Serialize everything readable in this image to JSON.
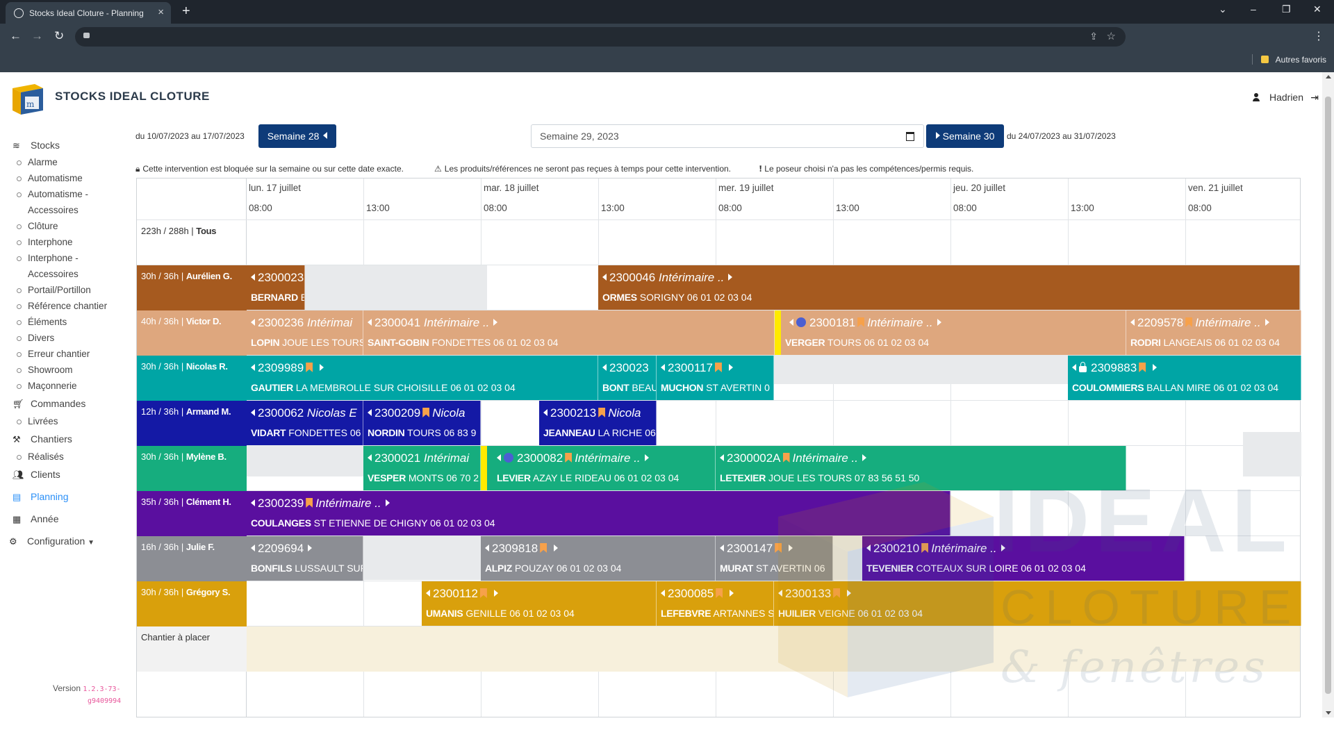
{
  "browser": {
    "tab_title": "Stocks Ideal Cloture - Planning",
    "bookmarks_label": "Autres favoris"
  },
  "app": {
    "brand": "STOCKS IDEAL CLOTURE",
    "user": "Hadrien",
    "version_label": "Version",
    "version_value": "1.2.3-73-",
    "version_hash": "g9409994"
  },
  "sidebar": {
    "stocks": "Stocks",
    "stock_items": [
      "Alarme",
      "Automatisme",
      "Automatisme -",
      "Accessoires",
      "Clôture",
      "Interphone",
      "Interphone -",
      "Accessoires",
      "Portail/Portillon",
      "Référence chantier",
      "Éléments",
      "Divers",
      "Erreur chantier",
      "Showroom",
      "Maçonnerie"
    ],
    "commandes": "Commandes",
    "livrees": "Livrées",
    "chantiers": "Chantiers",
    "realises": "Réalisés",
    "clients": "Clients",
    "planning": "Planning",
    "annee": "Année",
    "configuration": "Configuration"
  },
  "week_nav": {
    "prev_range": "du 10/07/2023 au 17/07/2023",
    "prev_label": "Semaine 28",
    "current": "Semaine 29, 2023",
    "next_label": "Semaine 30",
    "next_range": "du 24/07/2023 au 31/07/2023"
  },
  "legend": {
    "blocked": "Cette intervention est bloquée sur la semaine ou sur cette date exacte.",
    "late": "Les produits/références ne seront pas reçues à temps pour cette intervention.",
    "skills": "Le poseur choisi n'a pas les compétences/permis requis."
  },
  "days": [
    "lun. 17 juillet",
    "mar. 18 juillet",
    "mer. 19 juillet",
    "jeu. 20 juillet",
    "ven. 21 juillet"
  ],
  "hours": [
    "08:00",
    "13:00",
    "08:00",
    "13:00",
    "08:00",
    "13:00",
    "08:00",
    "13:00",
    "08:00"
  ],
  "rows": {
    "all": {
      "hours": "223h / 288h",
      "name": "Tous"
    },
    "aurelien": {
      "hours": "30h / 36h",
      "name": "Aurélien G.",
      "color": "#a65a1f"
    },
    "victor": {
      "hours": "40h / 36h",
      "name": "Victor D.",
      "color": "#dea77e"
    },
    "nicolas": {
      "hours": "30h / 36h",
      "name": "Nicolas R.",
      "color": "#00a5a5"
    },
    "armand": {
      "hours": "12h / 36h",
      "name": "Armand M.",
      "color": "#1419a5"
    },
    "mylene": {
      "hours": "30h / 36h",
      "name": "Mylène B.",
      "color": "#16ad7e"
    },
    "clement": {
      "hours": "35h / 36h",
      "name": "Clément H.",
      "color": "#5a0f9f"
    },
    "julie": {
      "hours": "16h / 36h",
      "name": "Julie F.",
      "color": "#8c8e94"
    },
    "gregory": {
      "hours": "30h / 36h",
      "name": "Grégory S.",
      "color": "#d9a00c"
    },
    "place": {
      "name": "Chantier à placer"
    }
  },
  "events": {
    "a1": {
      "code": "2300023",
      "flag": "",
      "name": "BERNARD",
      "rest": "E"
    },
    "a2": {
      "code": "2300046",
      "flag": "Intérimaire ..",
      "name": "ORMES",
      "rest": "SORIGNY 06 01 02 03 04"
    },
    "v1": {
      "code": "2300236",
      "flag": "Intérimai",
      "name": "LOPIN",
      "rest": "JOUE LES TOURS"
    },
    "v2": {
      "code": "2300041",
      "flag": "Intérimaire ..",
      "name": "SAINT-GOBIN",
      "rest": "FONDETTES 06 01 02 03 04"
    },
    "v3": {
      "code": "2300181",
      "flag": "Intérimaire ..",
      "name": "VERGER",
      "rest": "TOURS 06 01 02 03 04"
    },
    "v4": {
      "code": "2209578",
      "flag": "Intérimaire ..",
      "name": "RODRI",
      "rest": "LANGEAIS 06 01 02 03 04"
    },
    "n1": {
      "code": "2309989",
      "flag": "",
      "name": "GAUTIER",
      "rest": "LA MEMBROLLE SUR CHOISILLE 06 01 02 03 04"
    },
    "n2": {
      "code": "230023",
      "flag": "",
      "name": "BONT",
      "rest": "BEAU"
    },
    "n3": {
      "code": "2300117",
      "flag": "",
      "name": "MUCHON",
      "rest": "ST AVERTIN 0"
    },
    "n4": {
      "code": "2309883",
      "flag": "",
      "name": "COULOMMIERS",
      "rest": "BALLAN MIRE 06 01 02 03 04"
    },
    "r1": {
      "code": "2300062",
      "flag": "Nicolas E",
      "name": "VIDART",
      "rest": "FONDETTES 06"
    },
    "r2": {
      "code": "2300209",
      "flag": "Nicola",
      "name": "NORDIN",
      "rest": "TOURS 06 83 9"
    },
    "r3": {
      "code": "2300213",
      "flag": "Nicola",
      "name": "JEANNEAU",
      "rest": "LA RICHE 06"
    },
    "m1": {
      "code": "2300021",
      "flag": "Intérimai",
      "name": "VESPER",
      "rest": "MONTS 06 70 2"
    },
    "m2": {
      "code": "2300082",
      "flag": "Intérimaire ..",
      "name": "LEVIER",
      "rest": "AZAY LE RIDEAU 06 01 02 03 04"
    },
    "m3": {
      "code": "2300002A",
      "flag": "Intérimaire ..",
      "name": "LETEXIER",
      "rest": "JOUE LES TOURS 07 83 56 51 50"
    },
    "c1": {
      "code": "2300239",
      "flag": "Intérimaire ..",
      "name": "COULANGES",
      "rest": "ST ETIENNE DE CHIGNY 06 01 02 03 04"
    },
    "j1": {
      "code": "2209694",
      "flag": "",
      "name": "BONFILS",
      "rest": "LUSSAULT SUF"
    },
    "j2": {
      "code": "2309818",
      "flag": "",
      "name": "ALPIZ",
      "rest": "POUZAY 06 01 02 03 04"
    },
    "j3": {
      "code": "2300147",
      "flag": "",
      "name": "MURAT",
      "rest": "ST AVERTIN 06"
    },
    "j4": {
      "code": "2300210",
      "flag": "Intérimaire ..",
      "name": "TEVENIER",
      "rest": "COTEAUX SUR LOIRE 06 01 02 03 04"
    },
    "g1": {
      "code": "2300112",
      "flag": "",
      "name": "UMANIS",
      "rest": "GENILLE 06 01 02 03 04"
    },
    "g2": {
      "code": "2300085",
      "flag": "",
      "name": "LEFEBVRE",
      "rest": "ARTANNES S"
    },
    "g3": {
      "code": "2300133",
      "flag": "",
      "name": "HUILIER",
      "rest": "VEIGNE 06 01 02 03 04"
    }
  },
  "watermark": {
    "line1": "IDEAL",
    "line2": "CLOTURE",
    "line3": "& fenêtres"
  }
}
